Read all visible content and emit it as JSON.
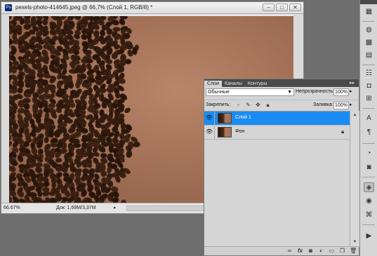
{
  "document": {
    "title": "pexels-photo-414645.jpeg @ 66,7% (Слой 1, RGB/8) *",
    "app_icon": "Ps",
    "window_buttons": [
      "–",
      "□",
      "✕"
    ],
    "zoom": "66.67%",
    "doc_size": "Док: 1,69M/3,37M",
    "status_arrow": "▸",
    "canvas_image": {
      "description_icon": "coffee-beans-photo",
      "bg_color": "#a6705a",
      "bean_color": "#2b170d"
    }
  },
  "layers_panel": {
    "tabs": [
      {
        "label": "Слои",
        "active": true
      },
      {
        "label": "Каналы",
        "active": false
      },
      {
        "label": "Контуры",
        "active": false
      }
    ],
    "collapse_glyph": "▸▸",
    "menu_glyph": "≡",
    "blend_mode": "Обычные",
    "opacity_label": "Непрозрачность:",
    "opacity_value": "100%",
    "lock_label": "Закрепить:",
    "fill_label": "Заливка:",
    "fill_value": "100%",
    "layers": [
      {
        "name": "Слой 1",
        "selected": true,
        "visible": true,
        "locked": false
      },
      {
        "name": "Фон",
        "selected": false,
        "visible": true,
        "locked": true
      }
    ],
    "footer_icons": [
      "link-icon",
      "fx-icon",
      "mask-icon",
      "adjustment-icon",
      "group-icon",
      "new-layer-icon",
      "trash-icon"
    ]
  },
  "tool_strip": {
    "icons": [
      "histogram-icon",
      "info-icon",
      "color-icon",
      "swatches-icon",
      "styles-icon",
      "adjustments-icon",
      "masks-icon",
      "character-icon",
      "paragraph-icon",
      "brush-preset-icon",
      "clone-source-icon",
      "layers-icon",
      "channels-icon",
      "paths-icon",
      "actions-icon"
    ]
  },
  "colors": {
    "selection": "#1a8bf2",
    "workspace": "#6e6e6e",
    "panel": "#d5d5d5"
  }
}
